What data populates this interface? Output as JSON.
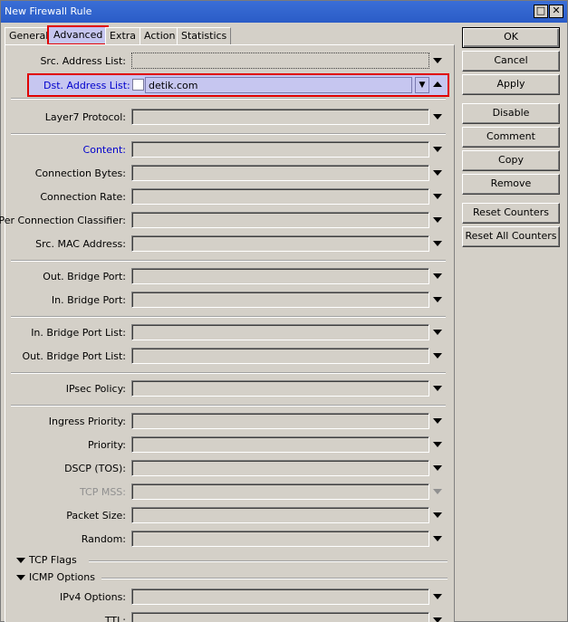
{
  "window": {
    "title": "New Firewall Rule",
    "maximize_glyph": "□",
    "close_glyph": "✕"
  },
  "tabs": [
    {
      "label": "General",
      "active": false
    },
    {
      "label": "Advanced",
      "active": true
    },
    {
      "label": "Extra",
      "active": false
    },
    {
      "label": "Action",
      "active": false
    },
    {
      "label": "Statistics",
      "active": false
    }
  ],
  "fields": {
    "src_address_list": {
      "label": "Src. Address List:",
      "value": ""
    },
    "dst_address_list": {
      "label": "Dst. Address List:",
      "value": "detik.com",
      "negate": false
    },
    "layer7_protocol": {
      "label": "Layer7 Protocol:",
      "value": ""
    },
    "content": {
      "label": "Content:",
      "value": ""
    },
    "connection_bytes": {
      "label": "Connection Bytes:",
      "value": ""
    },
    "connection_rate": {
      "label": "Connection Rate:",
      "value": ""
    },
    "per_connection_classifier": {
      "label": "Per Connection Classifier:",
      "value": ""
    },
    "src_mac_address": {
      "label": "Src. MAC Address:",
      "value": ""
    },
    "out_bridge_port": {
      "label": "Out. Bridge Port:",
      "value": ""
    },
    "in_bridge_port": {
      "label": "In. Bridge Port:",
      "value": ""
    },
    "in_bridge_port_list": {
      "label": "In. Bridge Port List:",
      "value": ""
    },
    "out_bridge_port_list": {
      "label": "Out. Bridge Port List:",
      "value": ""
    },
    "ipsec_policy": {
      "label": "IPsec Policy:",
      "value": ""
    },
    "ingress_priority": {
      "label": "Ingress Priority:",
      "value": ""
    },
    "priority": {
      "label": "Priority:",
      "value": ""
    },
    "dscp": {
      "label": "DSCP (TOS):",
      "value": ""
    },
    "tcp_mss": {
      "label": "TCP MSS:",
      "value": "",
      "disabled": true
    },
    "packet_size": {
      "label": "Packet Size:",
      "value": ""
    },
    "random": {
      "label": "Random:",
      "value": ""
    },
    "ipv4_options": {
      "label": "IPv4 Options:",
      "value": ""
    },
    "ttl": {
      "label": "TTL:",
      "value": ""
    }
  },
  "sections": {
    "tcp_flags": "TCP Flags",
    "icmp_options": "ICMP Options"
  },
  "buttons": {
    "ok": "OK",
    "cancel": "Cancel",
    "apply": "Apply",
    "disable": "Disable",
    "comment": "Comment",
    "copy": "Copy",
    "remove": "Remove",
    "reset_counters": "Reset Counters",
    "reset_all_counters": "Reset All Counters"
  },
  "colors": {
    "highlight": "#e00000",
    "selected_bg": "#c6c6f0",
    "link_label": "#0000cc",
    "disabled_label": "#909090"
  }
}
